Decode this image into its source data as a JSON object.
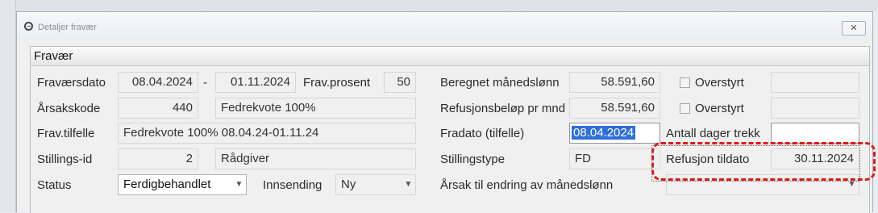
{
  "window": {
    "title": "Detaljer fravær",
    "close_glyph": "✕"
  },
  "panel": {
    "title": "Fravær"
  },
  "left": {
    "fravaersdato_label": "Fraværsdato",
    "fravaersdato_from": "08.04.2024",
    "dash": "-",
    "fravaersdato_to": "01.11.2024",
    "fravprosent_label": "Frav.prosent",
    "fravprosent_value": "50",
    "arsakskode_label": "Årsakskode",
    "arsakskode_value": "440",
    "arsakskode_text": "Fedrekvote 100%",
    "fravtilfelle_label": "Frav.tilfelle",
    "fravtilfelle_value": "Fedrekvote 100% 08.04.24-01.11.24",
    "stillingsid_label": "Stillings-id",
    "stillingsid_value": "2",
    "stillingsid_text": "Rådgiver",
    "status_label": "Status",
    "status_value": "Ferdigbehandlet",
    "innsending_label": "Innsending",
    "innsending_value": "Ny"
  },
  "right": {
    "beregnet_label": "Beregnet månedslønn",
    "beregnet_value": "58.591,60",
    "overstyrt1_label": "Overstyrt",
    "refusjon_label": "Refusjonsbeløp pr mnd",
    "refusjon_value": "58.591,60",
    "overstyrt2_label": "Overstyrt",
    "fradato_label": "Fradato (tilfelle)",
    "fradato_value": "08.04.2024",
    "antall_label": "Antall dager trekk",
    "antall_value": "",
    "stillingstype_label": "Stillingstype",
    "stillingstype_value": "FD",
    "refusjon_tildato_label": "Refusjon tildato",
    "refusjon_tildato_value": "30.11.2024",
    "arsak_label": "Årsak til endring av månedslønn",
    "arsak_value": ""
  },
  "icons": {
    "dropdown": "chevron-down-icon",
    "app": "app-logo-icon"
  },
  "colors": {
    "selection": "#2f6fd8",
    "highlight": "#e01a1a"
  }
}
